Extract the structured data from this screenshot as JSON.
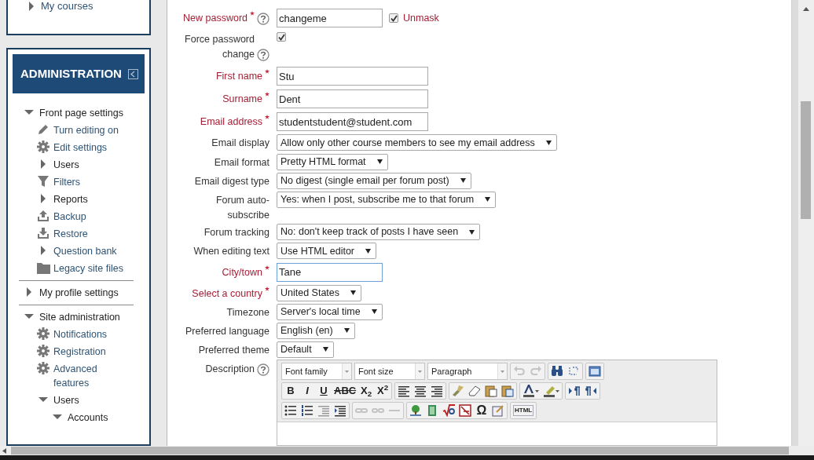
{
  "sidebar": {
    "top_block": {
      "items": [
        {
          "label": "My courses",
          "expanded": false
        }
      ]
    },
    "administration": {
      "title": "ADMINISTRATION",
      "tree": [
        {
          "label": "Front page settings",
          "kind": "branch",
          "expanded": true,
          "children": [
            {
              "label": "Turn editing on",
              "kind": "pencil"
            },
            {
              "label": "Edit settings",
              "kind": "gear"
            },
            {
              "label": "Users",
              "kind": "branch",
              "expanded": false
            },
            {
              "label": "Filters",
              "kind": "filter"
            },
            {
              "label": "Reports",
              "kind": "branch",
              "expanded": false
            },
            {
              "label": "Backup",
              "kind": "upload"
            },
            {
              "label": "Restore",
              "kind": "download"
            },
            {
              "label": "Question bank",
              "kind": "branch",
              "expanded": false
            },
            {
              "label": "Legacy site files",
              "kind": "folder"
            }
          ]
        },
        {
          "label": "My profile settings",
          "kind": "branch",
          "expanded": false,
          "divider": true
        },
        {
          "label": "Site administration",
          "kind": "branch",
          "expanded": true,
          "divider": true,
          "children": [
            {
              "label": "Notifications",
              "kind": "gear"
            },
            {
              "label": "Registration",
              "kind": "gear"
            },
            {
              "label": "Advanced features",
              "kind": "gear"
            },
            {
              "label": "Users",
              "kind": "branch",
              "expanded": true,
              "children": [
                {
                  "label": "Accounts",
                  "kind": "branch",
                  "expanded": true
                }
              ]
            }
          ]
        }
      ]
    }
  },
  "form": {
    "fields": [
      {
        "label": "New password",
        "kind": "text",
        "required": true,
        "help": true,
        "value": "changeme",
        "unmask": {
          "checked": true,
          "label": "Unmask"
        }
      },
      {
        "label": "Force password change",
        "kind": "checkbox",
        "required": false,
        "help": true,
        "checked": true
      },
      {
        "label": "First name",
        "kind": "text",
        "required": true,
        "value": "Stu"
      },
      {
        "label": "Surname",
        "kind": "text",
        "required": true,
        "value": "Dent"
      },
      {
        "label": "Email address",
        "kind": "text",
        "required": true,
        "value": "studentstudent@student.com"
      },
      {
        "label": "Email display",
        "kind": "select",
        "required": false,
        "value": "Allow only other course members to see my email address"
      },
      {
        "label": "Email format",
        "kind": "select",
        "required": false,
        "value": "Pretty HTML format"
      },
      {
        "label": "Email digest type",
        "kind": "select",
        "required": false,
        "value": "No digest (single email per forum post)"
      },
      {
        "label": "Forum auto-subscribe",
        "kind": "select",
        "required": false,
        "value": "Yes: when I post, subscribe me to that forum"
      },
      {
        "label": "Forum tracking",
        "kind": "select",
        "required": false,
        "value": "No: don't keep track of posts I have seen"
      },
      {
        "label": "When editing text",
        "kind": "select",
        "required": false,
        "value": "Use HTML editor"
      },
      {
        "label": "City/town",
        "kind": "text",
        "required": true,
        "value": "Tane",
        "focused": true
      },
      {
        "label": "Select a country",
        "kind": "select",
        "required": true,
        "value": "United States"
      },
      {
        "label": "Timezone",
        "kind": "select",
        "required": false,
        "value": "Server's local time"
      },
      {
        "label": "Preferred language",
        "kind": "select",
        "required": false,
        "value": "English (en)"
      },
      {
        "label": "Preferred theme",
        "kind": "select",
        "required": false,
        "value": "Default"
      },
      {
        "label": "Description",
        "kind": "editor",
        "required": false,
        "help": true
      }
    ],
    "editor": {
      "rows": [
        [
          [
            {
              "kind": "dropdown",
              "label": "Font family"
            }
          ],
          [
            {
              "kind": "dropdown",
              "label": "Font size"
            }
          ],
          [
            {
              "kind": "dropdown",
              "label": "Paragraph"
            }
          ],
          [
            {
              "kind": "undo",
              "disabled": true
            },
            {
              "kind": "redo",
              "disabled": true
            }
          ],
          [
            {
              "kind": "find"
            },
            {
              "kind": "replace"
            }
          ],
          [
            {
              "kind": "fullscreen"
            }
          ]
        ],
        [
          [
            {
              "kind": "format",
              "label": "B"
            },
            {
              "kind": "format",
              "label": "I"
            },
            {
              "kind": "format",
              "label": "U"
            },
            {
              "kind": "format",
              "label": "ABC"
            },
            {
              "kind": "format",
              "label": "X$_{2}$"
            },
            {
              "kind": "format",
              "label": "X$^{2}$"
            }
          ],
          [
            {
              "kind": "align-left"
            },
            {
              "kind": "align-center"
            },
            {
              "kind": "align-right"
            }
          ],
          [
            {
              "kind": "brush"
            },
            {
              "kind": "eraser"
            },
            {
              "kind": "paste-text"
            },
            {
              "kind": "paste-word"
            }
          ],
          [
            {
              "kind": "text-color"
            },
            {
              "kind": "highlight"
            }
          ],
          [
            {
              "kind": "ltr"
            },
            {
              "kind": "rtl"
            }
          ]
        ],
        [
          [
            {
              "kind": "bullets"
            },
            {
              "kind": "numbers"
            },
            {
              "kind": "outdent"
            },
            {
              "kind": "indent"
            }
          ],
          [
            {
              "kind": "link",
              "disabled": true
            },
            {
              "kind": "unlink",
              "disabled": true
            },
            {
              "kind": "anchor",
              "disabled": true
            }
          ],
          [
            {
              "kind": "image"
            },
            {
              "kind": "media"
            },
            {
              "kind": "equation"
            },
            {
              "kind": "nolink"
            },
            {
              "kind": "char",
              "label": "Ω"
            },
            {
              "kind": "note"
            }
          ],
          [
            {
              "kind": "label",
              "label": "HTML"
            }
          ]
        ]
      ]
    }
  }
}
